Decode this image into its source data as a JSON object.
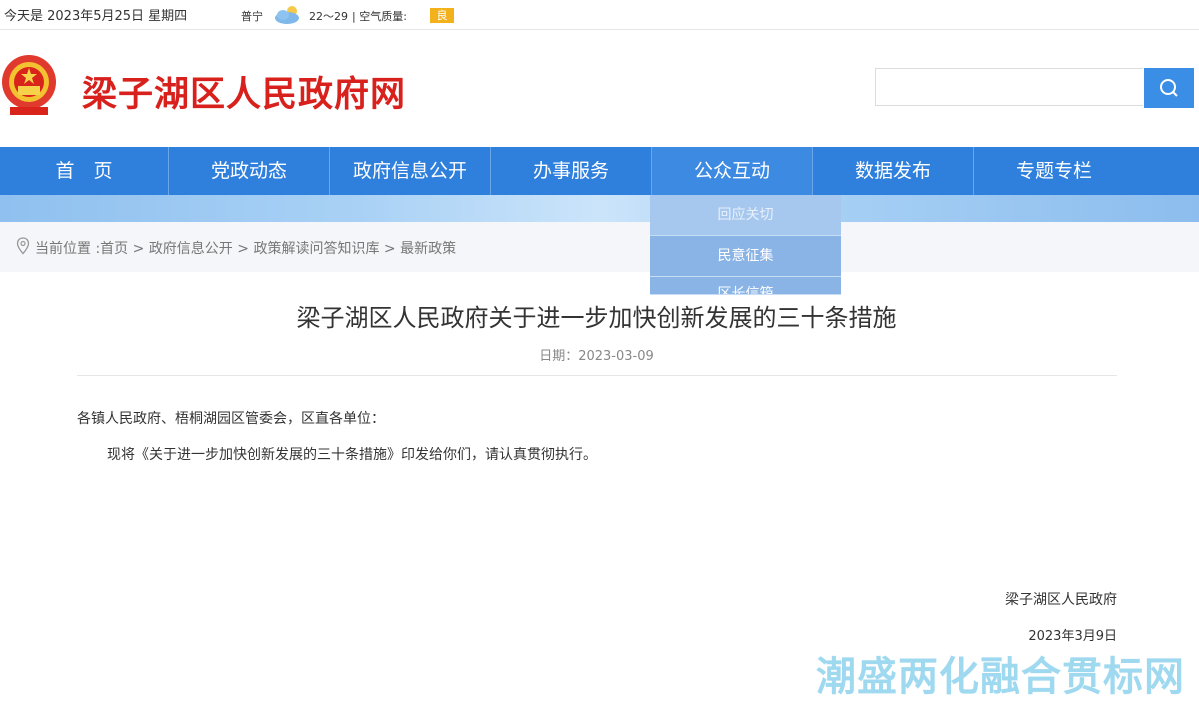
{
  "topbar": {
    "date": "今天是 2023年5月25日 星期四",
    "city": "普宁",
    "weather_icon": "cloud-sun-icon",
    "temp": "22～29",
    "air_quality_label": "| 空气质量:",
    "air_quality_value": "良"
  },
  "header": {
    "site_title": "梁子湖区人民政府网",
    "search_placeholder": "",
    "search_icon": "search-icon"
  },
  "nav": {
    "items": [
      {
        "label": "首　页"
      },
      {
        "label": "党政动态"
      },
      {
        "label": "政府信息公开"
      },
      {
        "label": "办事服务"
      },
      {
        "label": "公众互动"
      },
      {
        "label": "数据发布"
      },
      {
        "label": "专题专栏"
      }
    ],
    "dropdown": [
      {
        "label": "回应关切"
      },
      {
        "label": "民意征集"
      },
      {
        "label": "区长信箱"
      }
    ]
  },
  "breadcrumb": {
    "prefix": "当前位置 :",
    "items": [
      "首页",
      "政府信息公开",
      "政策解读问答知识库",
      "最新政策"
    ],
    "separator": " > "
  },
  "article": {
    "title": "梁子湖区人民政府关于进一步加快创新发展的三十条措施",
    "date": "日期：2023-03-09",
    "para1": "各镇人民政府、梧桐湖园区管委会，区直各单位：",
    "para2": "现将《关于进一步加快创新发展的三十条措施》印发给你们，请认真贯彻执行。",
    "sign_org": "梁子湖区人民政府",
    "sign_date": "2023年3月9日"
  },
  "watermark": "潮盛两化融合贯标网",
  "colors": {
    "nav_bg": "#2f7fdc",
    "title_red": "#d8211c",
    "search_btn": "#3a8ee6",
    "aq_badge": "#f3b21c"
  }
}
